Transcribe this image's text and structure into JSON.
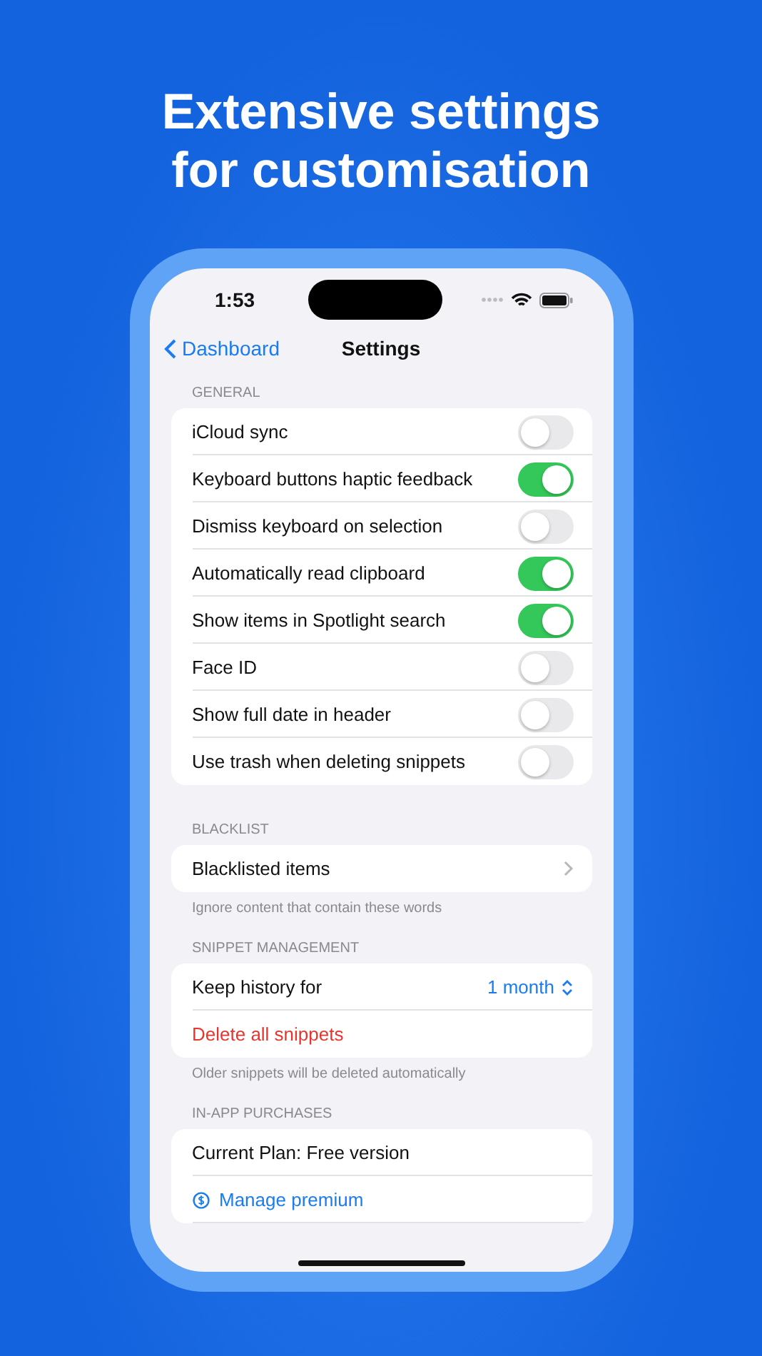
{
  "headline": "Extensive settings\nfor customisation",
  "status_bar": {
    "time": "1:53"
  },
  "nav": {
    "back": "Dashboard",
    "title": "Settings"
  },
  "sections": [
    {
      "header": "GENERAL",
      "rows": [
        {
          "kind": "toggle",
          "label": "iCloud sync",
          "on": false
        },
        {
          "kind": "toggle",
          "label": "Keyboard buttons haptic feedback",
          "on": true
        },
        {
          "kind": "toggle",
          "label": "Dismiss keyboard on selection",
          "on": false
        },
        {
          "kind": "toggle",
          "label": "Automatically read clipboard",
          "on": true
        },
        {
          "kind": "toggle",
          "label": "Show items in Spotlight search",
          "on": true
        },
        {
          "kind": "toggle",
          "label": "Face ID",
          "on": false
        },
        {
          "kind": "toggle",
          "label": "Show full date in header",
          "on": false
        },
        {
          "kind": "toggle",
          "label": "Use trash when deleting snippets",
          "on": false
        }
      ]
    },
    {
      "header": "BLACKLIST",
      "rows": [
        {
          "kind": "link",
          "label": "Blacklisted items"
        }
      ],
      "footer": "Ignore content that contain these words"
    },
    {
      "header": "SNIPPET MANAGEMENT",
      "rows": [
        {
          "kind": "picker",
          "label": "Keep history for",
          "value": "1 month"
        },
        {
          "kind": "destructive",
          "label": "Delete all snippets"
        }
      ],
      "footer": "Older snippets will be deleted automatically"
    },
    {
      "header": "IN-APP PURCHASES",
      "rows": [
        {
          "kind": "plain",
          "label": "Current Plan: Free version"
        },
        {
          "kind": "action",
          "label": "Manage premium"
        }
      ]
    }
  ]
}
